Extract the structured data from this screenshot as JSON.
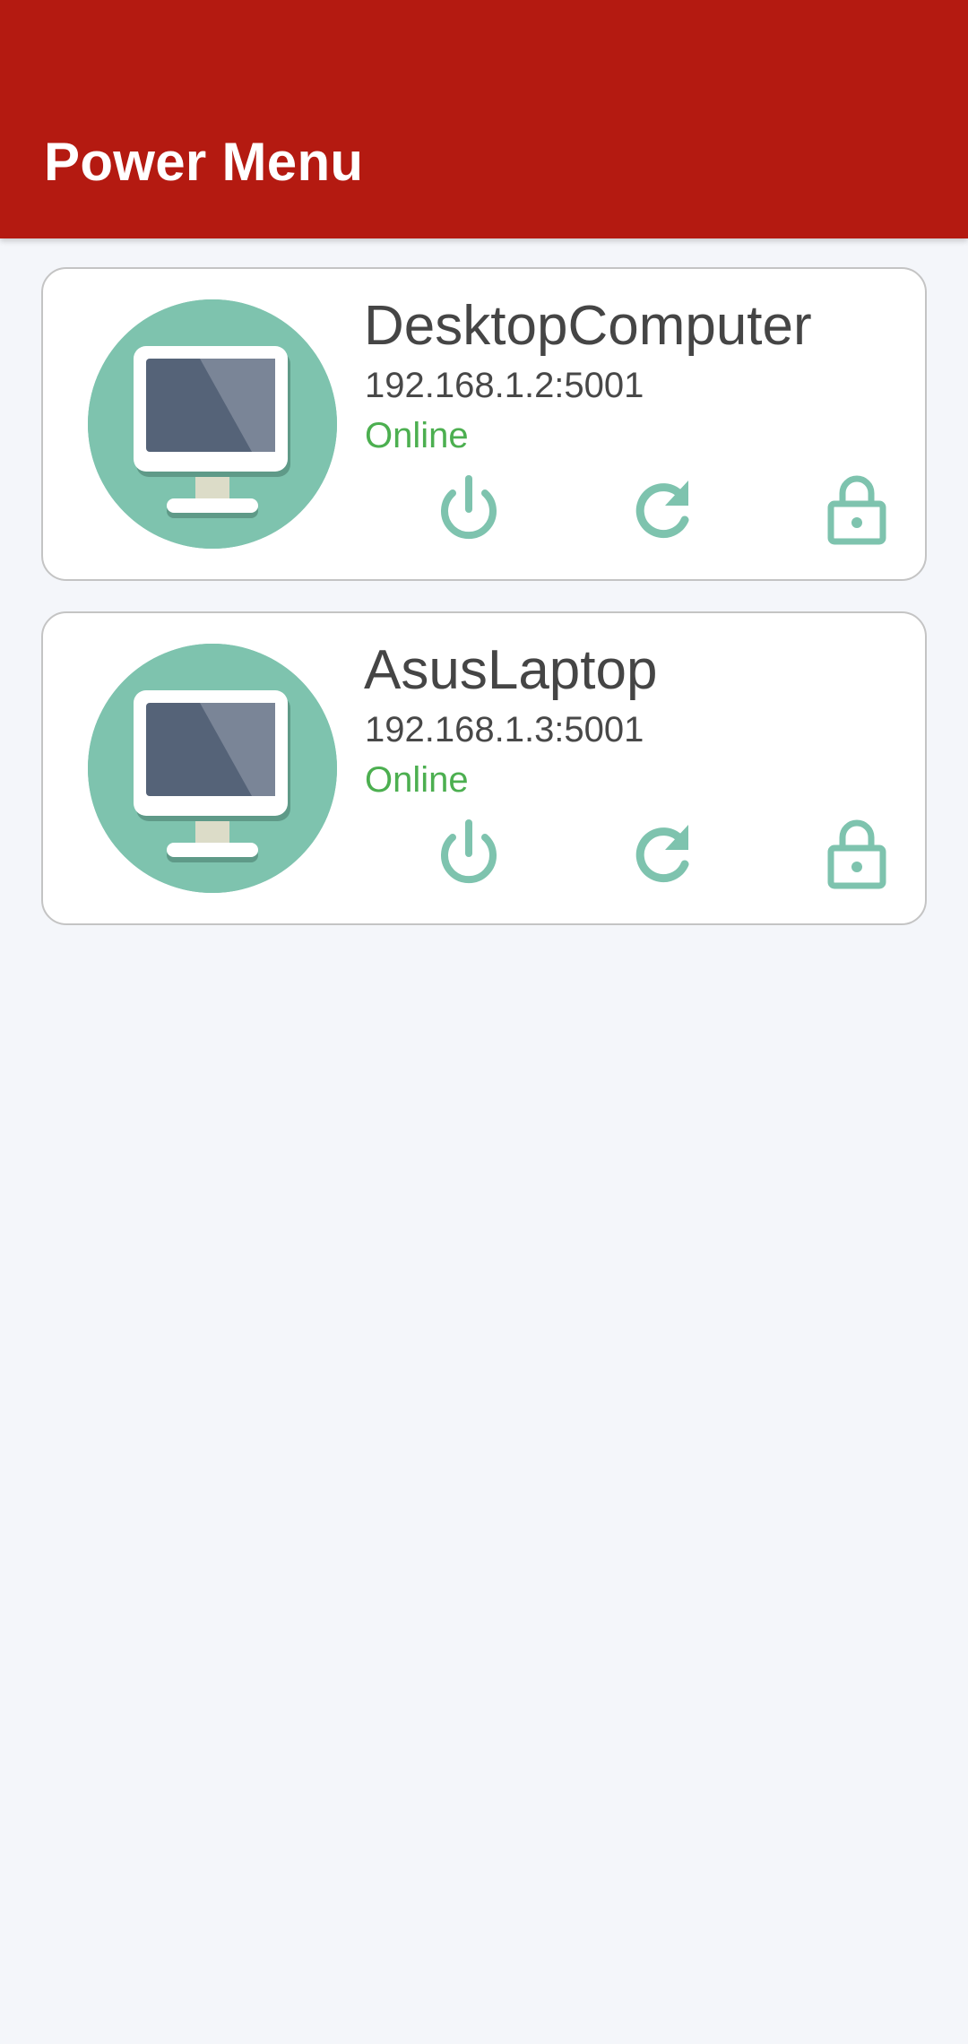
{
  "appbar": {
    "title": "Power Menu",
    "color": "#b41a11"
  },
  "accent_color": "#7ec3ae",
  "status_color": "#4caf50",
  "devices": [
    {
      "name": "DesktopComputer",
      "address": "192.168.1.2:5001",
      "status": "Online",
      "icon": "monitor-icon",
      "actions": [
        "power-icon",
        "restart-icon",
        "lock-icon"
      ]
    },
    {
      "name": "AsusLaptop",
      "address": "192.168.1.3:5001",
      "status": "Online",
      "icon": "monitor-icon",
      "actions": [
        "power-icon",
        "restart-icon",
        "lock-icon"
      ]
    }
  ]
}
